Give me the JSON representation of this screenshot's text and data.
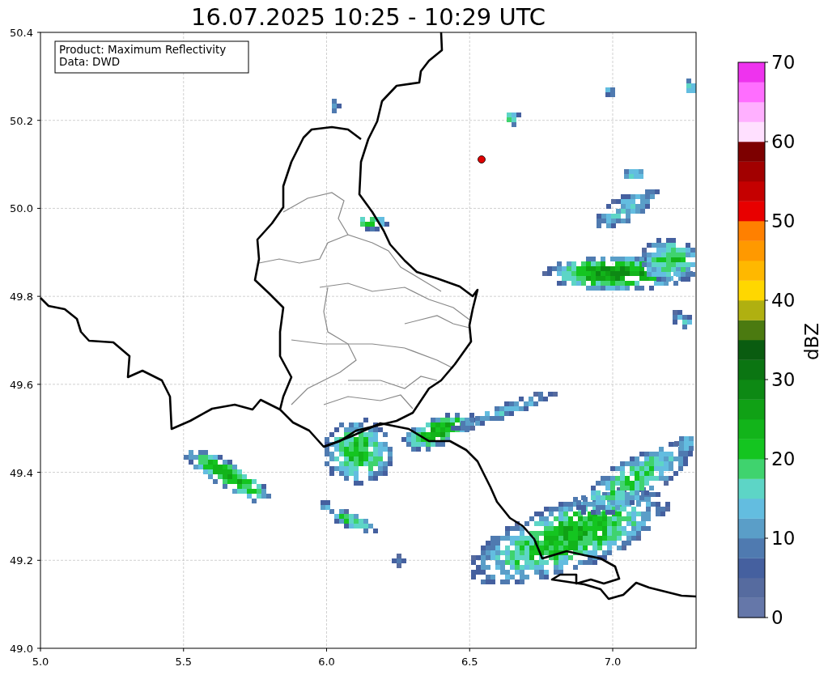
{
  "title": "16.07.2025 10:25 - 10:29 UTC",
  "info_box": [
    "Product: Maximum Reflectivity",
    "Data: DWD"
  ],
  "map": {
    "x_ticks": [
      "5.0",
      "5.5",
      "6.0",
      "6.5",
      "7.0"
    ],
    "y_ticks": [
      "50.4",
      "50.2",
      "50.0",
      "49.8",
      "49.6",
      "49.4",
      "49.2",
      "49.0"
    ]
  },
  "colorbar": {
    "label": "dBZ",
    "ticks": [
      "70",
      "60",
      "50",
      "40",
      "30",
      "20",
      "10",
      "0"
    ],
    "segments": [
      {
        "color": "#6577a9"
      },
      {
        "color": "#566b9f"
      },
      {
        "color": "#45609f"
      },
      {
        "color": "#4f7ab0"
      },
      {
        "color": "#5a9ec8"
      },
      {
        "color": "#63bde0"
      },
      {
        "color": "#5dd5c6"
      },
      {
        "color": "#3fd36e"
      },
      {
        "color": "#14c520"
      },
      {
        "color": "#12b41a"
      },
      {
        "color": "#10a115"
      },
      {
        "color": "#0d8914"
      },
      {
        "color": "#0b7512"
      },
      {
        "color": "#0a5c10"
      },
      {
        "color": "#4b7a10"
      },
      {
        "color": "#b0b010"
      },
      {
        "color": "#ffd700"
      },
      {
        "color": "#ffb800"
      },
      {
        "color": "#ff9900"
      },
      {
        "color": "#ff8000"
      },
      {
        "color": "#e80000"
      },
      {
        "color": "#c50000"
      },
      {
        "color": "#a20000"
      },
      {
        "color": "#7d0000"
      },
      {
        "color": "#ffe0ff"
      },
      {
        "color": "#ffb0ff"
      },
      {
        "color": "#ff6eff"
      },
      {
        "color": "#ee33ee"
      }
    ]
  }
}
